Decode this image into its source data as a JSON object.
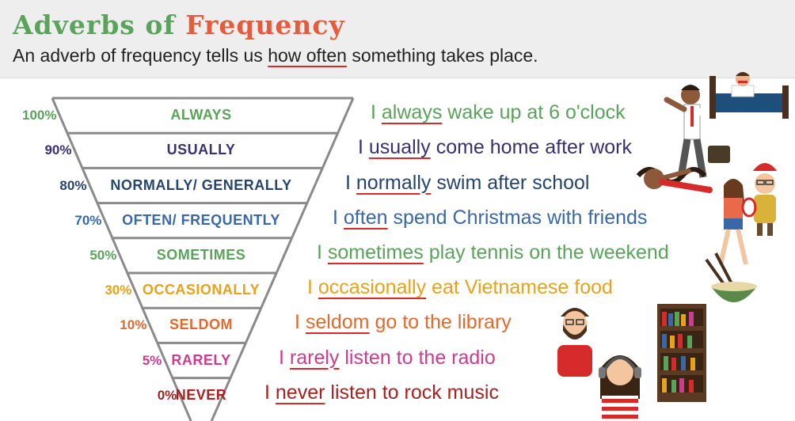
{
  "header": {
    "title_part1": "Adverbs of",
    "title_part2": "Frequency",
    "subtitle_before": "An adverb of frequency tells us",
    "subtitle_highlight": "how often",
    "subtitle_after": "something takes place."
  },
  "rows": [
    {
      "percent": "100%",
      "adverb": "ALWAYS",
      "before": "I",
      "keyword": "always",
      "after": "wake up at 6 o'clock",
      "color": "#5aa35b"
    },
    {
      "percent": "90%",
      "adverb": "USUALLY",
      "before": "I",
      "keyword": "usually",
      "after": "come home after work",
      "color": "#3b2f6e"
    },
    {
      "percent": "80%",
      "adverb": "NORMALLY/ GENERALLY",
      "before": "I",
      "keyword": "normally",
      "after": "swim after school",
      "color": "#25456e"
    },
    {
      "percent": "70%",
      "adverb": "OFTEN/ FREQUENTLY",
      "before": "I",
      "keyword": "often",
      "after": "spend Christmas with friends",
      "color": "#3a68a6"
    },
    {
      "percent": "50%",
      "adverb": "SOMETIMES",
      "before": "I",
      "keyword": "sometimes",
      "after": "play tennis on the weekend",
      "color": "#5aa35b"
    },
    {
      "percent": "30%",
      "adverb": "OCCASIONALLY",
      "before": "I",
      "keyword": "occasionally",
      "after": "eat Vietnamese food",
      "color": "#e8a21a"
    },
    {
      "percent": "10%",
      "adverb": "SELDOM",
      "before": "I",
      "keyword": "seldom",
      "after": "go to the library",
      "color": "#e26a2c"
    },
    {
      "percent": "5%",
      "adverb": "RARELY",
      "before": "I",
      "keyword": "rarely",
      "after": "listen to the radio",
      "color": "#cc3c8f"
    },
    {
      "percent": "0%",
      "adverb": "NEVER",
      "before": "I",
      "keyword": "never",
      "after": "listen to rock music",
      "color": "#a8221f"
    }
  ],
  "colors": {
    "funnel_line": "#8a8a8a",
    "underline": "#d62b2b",
    "header_bg": "#eeeeee"
  },
  "icons": [
    "man-in-bed-icon",
    "running-businessman-icon",
    "swimmer-icon",
    "christmas-girl-icon",
    "tennis-player-icon",
    "noodle-bowl-icon",
    "bearded-man-icon",
    "bookshelf-icon",
    "girl-with-headphones-icon"
  ]
}
